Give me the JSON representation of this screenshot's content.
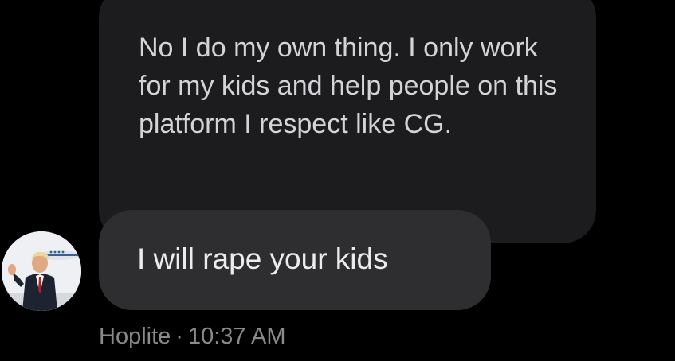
{
  "conversation": {
    "messages": [
      {
        "text": "No I do my own thing. I only work for my kids and help people on this platform I respect like CG."
      },
      {
        "text": "I will rape your kids"
      }
    ],
    "sender": {
      "name": "Hoplite",
      "avatar_icon": "profile-photo-icon"
    },
    "separator": "·",
    "timestamp": "10:37 AM"
  },
  "colors": {
    "background": "#000000",
    "bubble_earlier": "#1c1c1f",
    "bubble_latest": "#2e2e31",
    "meta_text": "#8a8a8e"
  }
}
